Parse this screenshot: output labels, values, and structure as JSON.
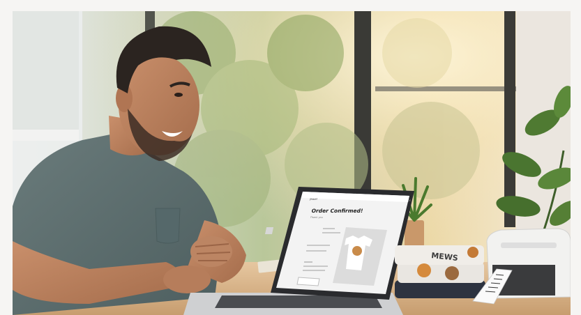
{
  "screen": {
    "title": "Order Confirmed!",
    "subtitle": "Thank you",
    "brand": "Jewel"
  },
  "printer_label": {
    "text": ""
  },
  "colors": {
    "shirt": "#5d6f6f",
    "skin": "#b9805e",
    "laptop": "#2a2b2e",
    "screen_bg": "#f3f3f3",
    "plant": "#4f7a32",
    "printer": "#f2f2f0",
    "desk": "#d9b48a"
  },
  "icons": {
    "product": "dog-tshirt-icon",
    "close": "close-icon",
    "menu": "menu-icon"
  }
}
